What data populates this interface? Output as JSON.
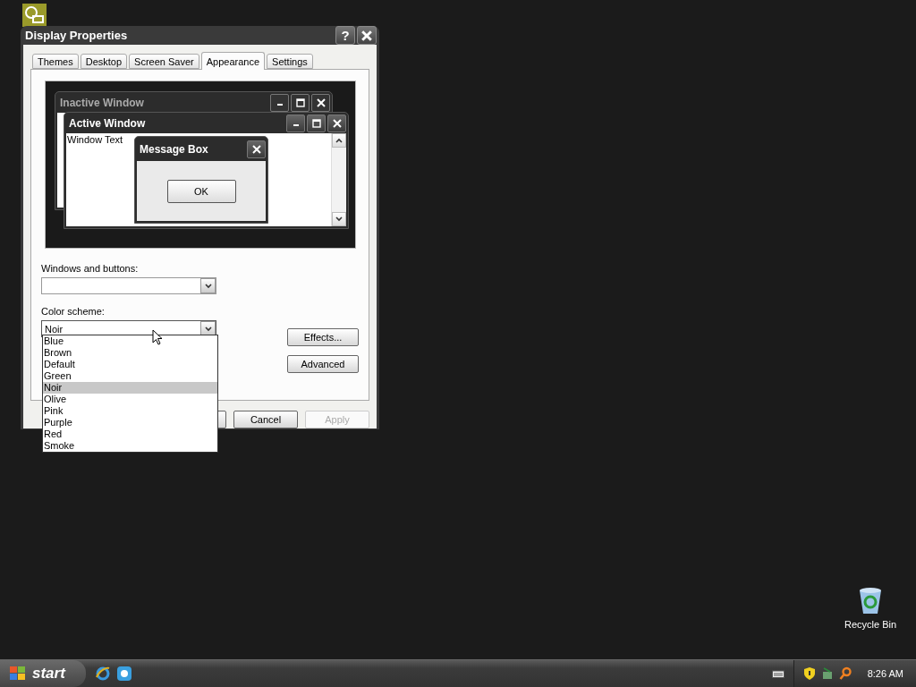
{
  "desktop": {
    "icons": [
      {
        "label": "Recycle Bin",
        "kind": "bin"
      }
    ]
  },
  "dialog": {
    "title": "Display Properties",
    "help": "?",
    "tabs": [
      {
        "label": "Themes",
        "selected": false
      },
      {
        "label": "Desktop",
        "selected": false
      },
      {
        "label": "Screen Saver",
        "selected": false
      },
      {
        "label": "Appearance",
        "selected": true
      },
      {
        "label": "Settings",
        "selected": false
      }
    ],
    "preview": {
      "inactive_title": "Inactive Window",
      "active_title": "Active Window",
      "window_text": "Window Text",
      "message_title": "Message Box",
      "ok": "OK"
    },
    "windows_and_buttons": {
      "label": "Windows and buttons:"
    },
    "color_scheme": {
      "label": "Color scheme:",
      "value": "Noir",
      "expanded": true,
      "options": [
        {
          "label": "Blue",
          "selected": false
        },
        {
          "label": "Brown",
          "selected": false
        },
        {
          "label": "Default",
          "selected": false
        },
        {
          "label": "Green",
          "selected": false
        },
        {
          "label": "Noir",
          "selected": true
        },
        {
          "label": "Olive",
          "selected": false
        },
        {
          "label": "Pink",
          "selected": false
        },
        {
          "label": "Purple",
          "selected": false
        },
        {
          "label": "Red",
          "selected": false
        },
        {
          "label": "Smoke",
          "selected": false
        }
      ]
    },
    "side_buttons": [
      "Effects...",
      "Advanced"
    ],
    "footer_buttons": [
      {
        "label": "Cancel",
        "disabled": false
      },
      {
        "label": "Apply",
        "disabled": true
      }
    ]
  },
  "taskbar": {
    "start": "start",
    "clock": "8:26 AM"
  }
}
